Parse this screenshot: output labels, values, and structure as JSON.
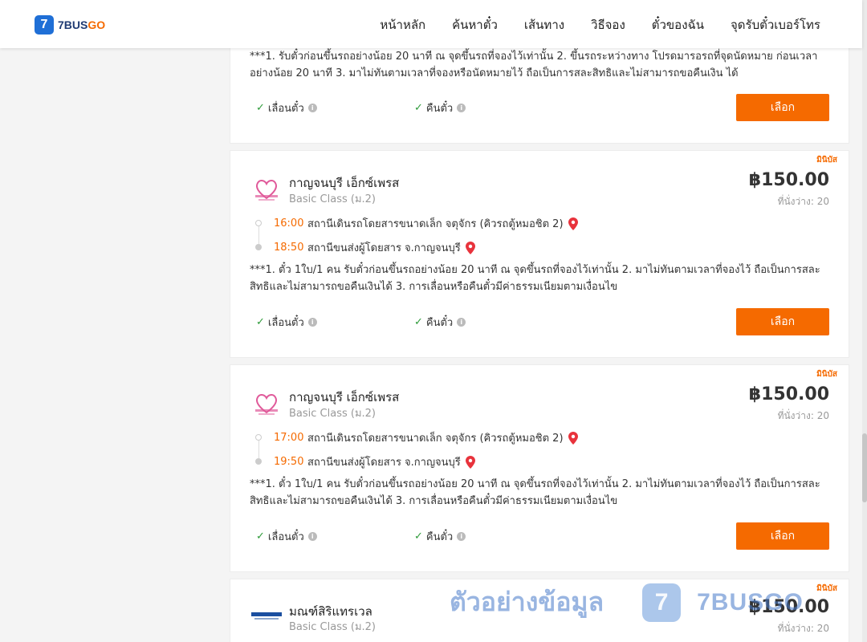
{
  "brand": {
    "logo_mark": "7",
    "name_prefix": "7BUS",
    "name_suffix": "GO"
  },
  "nav": [
    "หน้าหลัก",
    "ค้นหาตั๋ว",
    "เส้นทาง",
    "วิธีจอง",
    "ตั๋วของฉัน",
    "จุดรับตั๋วเบอร์โทร"
  ],
  "first_card": {
    "note": "***1. รับตั๋วก่อนขึ้นรถอย่างน้อย 20 นาที ณ จุดขึ้นรถที่จองไว้เท่านั้น 2. ขึ้นรถระหว่างทาง โปรดมารอรถที่จุดนัดหมาย ก่อนเวลาอย่างน้อย 20 นาที 3. มาไม่ทันตามเวลาที่จองหรือนัดหมายไว้ ถือเป็นการสละสิทธิและไม่สามารถขอคืนเงิน ได้",
    "reschedule": "เลื่อนตั๋ว",
    "refund": "คืนตั๋ว",
    "select": "เลือก"
  },
  "trips": [
    {
      "badge": "มินิบัส",
      "operator": "กาญจนบุรี เอ็กซ์เพรส",
      "bus_class": "Basic Class (ม.2)",
      "price": "฿150.00",
      "seats": "ที่นั่งว่าง: 20",
      "depart_time": "16:00",
      "depart_station": "สถานีเดินรถโดยสารขนาดเล็ก จตุจักร (คิวรถตู้หมอชิต 2)",
      "arrive_time": "18:50",
      "arrive_station": "สถานีขนส่งผู้โดยสาร จ.กาญจนบุรี",
      "note": "***1. ตั๋ว 1ใบ/1 คน รับตั๋วก่อนขึ้นรถอย่างน้อย 20 นาที ณ จุดขึ้นรถที่จองไว้เท่านั้น 2. มาไม่ทันตามเวลาที่จองไว้ ถือเป็นการสละสิทธิและไม่สามารถขอคืนเงินได้ 3. การเลื่อนหรือคืนตั๋วมีค่าธรรมเนียมตามเงื่อนไข",
      "reschedule": "เลื่อนตั๋ว",
      "refund": "คืนตั๋ว",
      "select": "เลือก"
    },
    {
      "badge": "มินิบัส",
      "operator": "กาญจนบุรี เอ็กซ์เพรส",
      "bus_class": "Basic Class (ม.2)",
      "price": "฿150.00",
      "seats": "ที่นั่งว่าง: 20",
      "depart_time": "17:00",
      "depart_station": "สถานีเดินรถโดยสารขนาดเล็ก จตุจักร (คิวรถตู้หมอชิต 2)",
      "arrive_time": "19:50",
      "arrive_station": "สถานีขนส่งผู้โดยสาร จ.กาญจนบุรี",
      "note": "***1. ตั๋ว 1ใบ/1 คน รับตั๋วก่อนขึ้นรถอย่างน้อย 20 นาที ณ จุดขึ้นรถที่จองไว้เท่านั้น 2. มาไม่ทันตามเวลาที่จองไว้ ถือเป็นการสละสิทธิและไม่สามารถขอคืนเงินได้ 3. การเลื่อนหรือคืนตั๋วมีค่าธรรมเนียมตามเงื่อนไข",
      "reschedule": "เลื่อนตั๋ว",
      "refund": "คืนตั๋ว",
      "select": "เลือก"
    },
    {
      "badge": "มินิบัส",
      "operator": "มณฑ์สิริแทรเวล",
      "bus_class": "Basic Class (ม.2)",
      "price": "฿150.00",
      "seats": "ที่นั่งว่าง: 20"
    }
  ],
  "watermark": {
    "text": "ตัวอย่างข้อมูล",
    "mark": "7",
    "brand": "7BUSGO"
  },
  "colors": {
    "accent": "#f56a00",
    "brand_blue": "#1f6fd6",
    "check_green": "#2e9b3a"
  },
  "icons": [
    "check-icon",
    "info-icon",
    "map-pin-icon",
    "heart-logo-icon"
  ]
}
